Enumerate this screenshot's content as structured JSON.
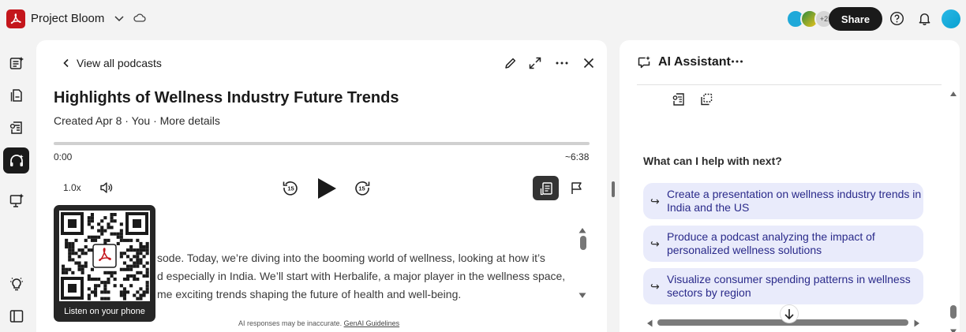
{
  "app": {
    "title": "Project Bloom",
    "brand_color": "#c4161c"
  },
  "header": {
    "collaborators_more": "+2",
    "share_label": "Share"
  },
  "podcast": {
    "back_label": "View all podcasts",
    "title": "Highlights of Wellness Industry Future Trends",
    "meta": "Created Apr 8 · You · More details",
    "time_current": "0:00",
    "time_total": "~6:38",
    "progress": 0,
    "speed": "1.0x",
    "skip_back_seconds": "15",
    "skip_forward_seconds": "15",
    "transcript_lines": [
      "sode. Today, we’re diving into the booming world of wellness, looking at how it’s",
      "d especially in India. We’ll start with Herbalife, a major player in the wellness space,",
      "me exciting trends shaping the future of health and well-being."
    ],
    "qr_label": "Listen on your phone",
    "disclaimer_text": "AI responses may be inaccurate. ",
    "disclaimer_link": "GenAI Guidelines"
  },
  "assistant": {
    "title": "AI Assistant",
    "prompt_heading": "What can I help with next?",
    "suggestions": [
      {
        "arrow": "↪",
        "line1": "Create a presentation on wellness industry trends in",
        "line2": "India and the US"
      },
      {
        "arrow": "↪",
        "line1": "Produce a podcast analyzing the impact of",
        "line2": "personalized wellness solutions"
      },
      {
        "arrow": "↪",
        "line1": "Visualize consumer spending patterns in wellness",
        "line2": "sectors by region"
      }
    ],
    "suggestion_bg": "#e9ebfb",
    "suggestion_text_color": "#2a2a8a"
  }
}
